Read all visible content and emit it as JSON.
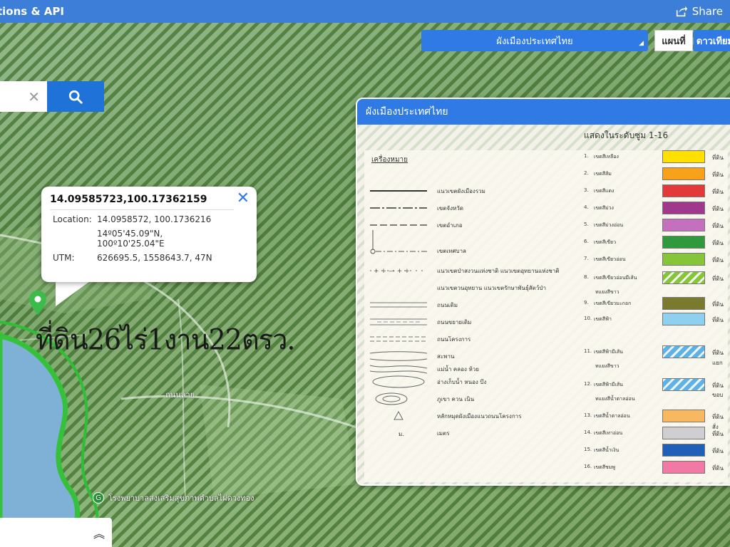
{
  "topbar": {
    "title": "tions & API",
    "share_label": "Share"
  },
  "layer_select": {
    "selected": "ผังเมืองประเทศไทย"
  },
  "map_type": {
    "map_label": "แผนที่",
    "satellite_label": "ดาวเทียม"
  },
  "search": {
    "clear_symbol": "✕"
  },
  "popup": {
    "title": "14.09585723,100.17362159",
    "location_label": "Location:",
    "location_value": "14.0958572, 100.1736216",
    "dms_lat": "14º05'45.09\"N,",
    "dms_lon": "100º10'25.04\"E",
    "utm_label": "UTM:",
    "utm_value": "626695.5, 1558643.7, 47N"
  },
  "map": {
    "plot_label": "ที่ดิน26ไร่1งาน22ตรว.",
    "road_label": "ถนนลาย",
    "poi_label": "โรงพยาบาลส่งเสริมสุขภาพตำบลไผ่ดวงทอง",
    "poi_icon": "G"
  },
  "bottom_panel": {
    "icon": "double-chevron-up-icon"
  },
  "legend": {
    "title": "ผังเมืองประเทศไทย",
    "range_label": "แสดงในระดับซูม 1-16",
    "symbols_title": "เครื่องหมาย",
    "symbols": [
      {
        "label": "แนวเขตผังเมืองรวม"
      },
      {
        "label": "เขตจังหวัด"
      },
      {
        "label": "เขตอำเภอ"
      },
      {
        "label": "เขตเทศบาล"
      },
      {
        "label": "แนวเขตป่าสงวนแห่งชาติ แนวเขตอุทยานแห่งชาติ"
      },
      {
        "label": "แนวเขตวนอุทยาน แนวเขตรักษาพันธุ์สัตว์ป่า"
      },
      {
        "label": "ถนนเดิม"
      },
      {
        "label": "ถนนขยายเดิม"
      },
      {
        "label": "ถนนโครงการ"
      },
      {
        "label": "สะพาน"
      },
      {
        "label": "แม่น้ำ คลอง ห้วย"
      },
      {
        "label": "อ่างเก็บน้ำ หนอง บึง"
      },
      {
        "label": "ภูเขา ควน เนิน"
      },
      {
        "label": "หลักหมุดผังเมืองแนวถนนโครงการ"
      },
      {
        "label": "เมตร",
        "prefix": "ม."
      }
    ],
    "zones": [
      {
        "num": "1.",
        "name": "เขตสีเหลือง",
        "color": "#ffe000",
        "desc": "ที่ดิน"
      },
      {
        "num": "2.",
        "name": "เขตสีส้ม",
        "color": "#f8a11a",
        "desc": "ที่ดิน"
      },
      {
        "num": "3.",
        "name": "เขตสีแดง",
        "color": "#e23a3a",
        "desc": "ที่ดิน"
      },
      {
        "num": "4.",
        "name": "เขตสีม่วง",
        "color": "#a0388e",
        "desc": "ที่ดิน"
      },
      {
        "num": "5.",
        "name": "เขตสีม่วงอ่อน",
        "color": "#c56fbf",
        "desc": "ที่ดิน"
      },
      {
        "num": "6.",
        "name": "เขตสีเขียว",
        "color": "#2e9a3c",
        "desc": "ที่ดิน"
      },
      {
        "num": "7.",
        "name": "เขตสีเขียวอ่อน",
        "color": "#86c43a",
        "desc": "ที่ดิน"
      },
      {
        "num": "8.",
        "name": "เขตสีเขียวอ่อนมีเส้น",
        "sub": "ทแยงสีขาว",
        "color": "#86c43a",
        "hatch": true,
        "desc": "ที่ดิน"
      },
      {
        "num": "9.",
        "name": "เขตสีเขียวมะกอก",
        "color": "#7a7a2e",
        "desc": "ที่ดิน"
      },
      {
        "num": "10.",
        "name": "เขตสีฟ้า",
        "color": "#8fd0ee",
        "desc": "ที่ดิน"
      },
      {
        "num": "11.",
        "name": "เขตสีฟ้ามีเส้น",
        "sub": "ทแยงสีขาว",
        "color": "#5fb2e6",
        "hatch": true,
        "desc": "ที่ดิน"
      },
      {
        "num": "12.",
        "name": "เขตสีฟ้ามีเส้น",
        "sub": "ทแยงสีน้ำตาลอ่อน",
        "color": "#5fb2e6",
        "hatch": true,
        "desc": "ที่ดิน"
      },
      {
        "num": "13.",
        "name": "เขตสีน้ำตาลอ่อน",
        "color": "#f8b860",
        "desc": "ที่ดิน"
      },
      {
        "num": "14.",
        "name": "เขตสีเทาอ่อน",
        "color": "#cfcfd2",
        "desc": "ที่ดิน"
      },
      {
        "num": "15.",
        "name": "เขตสีน้ำเงิน",
        "color": "#1f5fb8",
        "desc": "ที่ดิน"
      },
      {
        "num": "16.",
        "name": "เขตสีชมพู",
        "color": "#f07aa4",
        "desc": "ที่ดิน"
      }
    ],
    "side_notes": [
      "แยก",
      "ขอบ",
      "สั่ง"
    ]
  }
}
